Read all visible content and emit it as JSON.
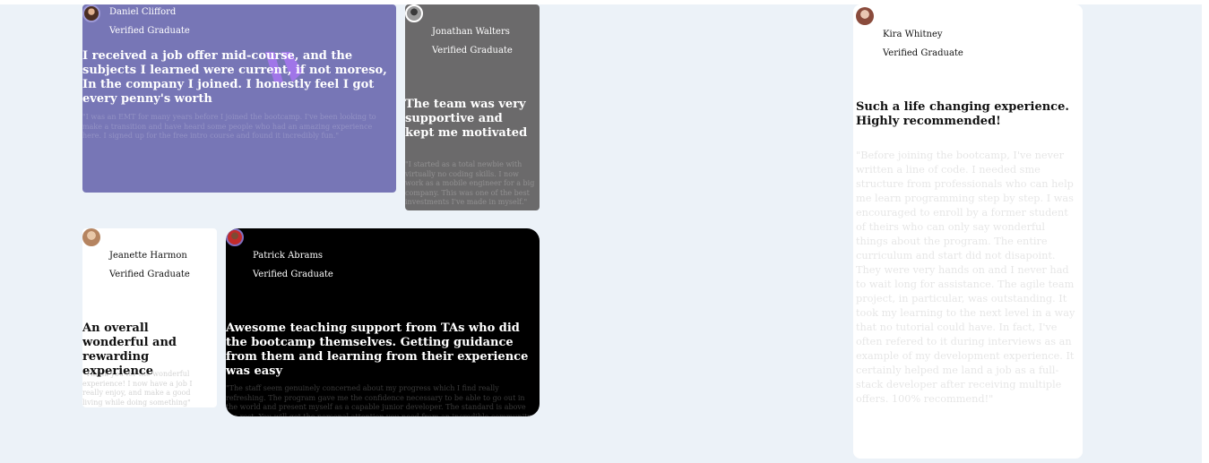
{
  "testimonials": [
    {
      "name": "Daniel Clifford",
      "role": "Verified Graduate",
      "headline": "I received a job offer mid-course, and the subjects I learned were current, if not moreso, In the company I joined. I honestly feel I got every penny's worth",
      "quote": "\"I was an EMT for many years before I joined the bootcamp. I've been looking to make a transition and have heard some people who had an amazing experience here. I signed up for the free intro course and found it incredibly fun.\"",
      "background": "#7776b6",
      "quote_icon": "quote-mark-icon"
    },
    {
      "name": "Jonathan Walters",
      "role": "Verified Graduate",
      "headline": "The team was very supportive and kept me motivated",
      "quote": "\"I started as a total newbie with virtually no coding skills. I now work as a mobile engineer for a big company. This was one of the best investments I've made in myself.\"",
      "background": "#6b6a6b"
    },
    {
      "name": "Jeanette Harmon",
      "role": "Verified Graduate",
      "headline": "An overall wonderful and rewarding experience",
      "quote": "\"Thank you for the wonderful experience! I now have a job I really enjoy, and make a good living while doing something\"",
      "background": "#ffffff"
    },
    {
      "name": "Patrick Abrams",
      "role": "Verified Graduate",
      "headline": "Awesome teaching support from TAs who did the bootcamp themselves. Getting guidance from them and learning from their experience was easy",
      "quote": "\"The staff seem genuinely concerned about my progress which I find really refreshing. The program gave me the confidence necessary to be able to go out in the world and present myself as a capable junior developer. The standard is above the rest. You will get the personal attention you need from an incredible community of smart and amazing people.\"",
      "background": "#000000"
    },
    {
      "name": "Kira Whitney",
      "role": "Verified Graduate",
      "headline": "Such a life changing experience. Highly recommended!",
      "quote": "\"Before joining the bootcamp, I've never written a line of code. I needed sme structure from professionals who can help me learn programming step by step. I was encouraged to enroll by a former student of theirs who can only say wonderful things about the program. The entire curriculum and start did not disapoint. They were very hands on and I never had to wait long for assistance. The agile team project, in particular, was outstanding. It took my learning to the next level in a way that no tutorial could have. In fact, I've often refered to it during interviews as an example of my development experience. It certainly helped me land a job as a full-stack developer after receiving multiple offers. 100% recommend!\"",
      "background": "#ffffff"
    }
  ],
  "colors": {
    "page_background": "#ecf2f8",
    "quote_icon": "#a775f1"
  }
}
